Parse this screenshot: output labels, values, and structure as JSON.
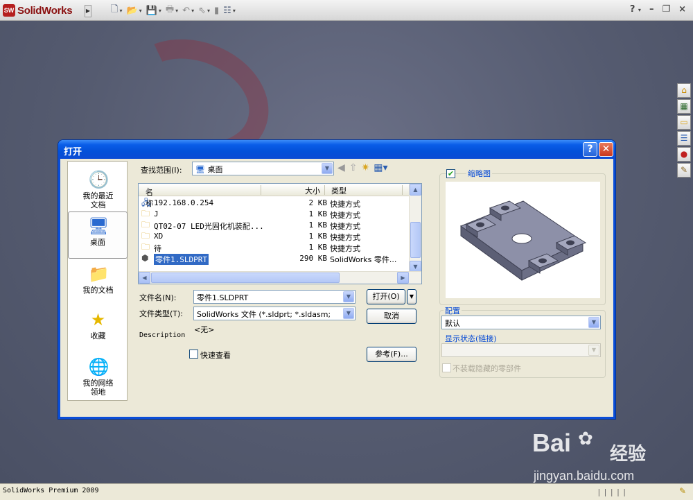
{
  "app": {
    "name": "SolidWorks",
    "logo_mark": "SW",
    "toolbar_icons": [
      "new-icon",
      "open-icon",
      "save-icon",
      "print-icon",
      "undo-icon",
      "select-icon",
      "rebuild-icon",
      "options-icon"
    ],
    "help_label": "?"
  },
  "status_bar": {
    "text": "SolidWorks Premium 2009"
  },
  "watermark": {
    "brand": "Bai",
    "brand_cn": "经验",
    "url": "jingyan.baidu.com"
  },
  "dialog": {
    "title": "打开",
    "places": [
      {
        "label": "我的最近\n文档",
        "icon": "recent-documents-icon"
      },
      {
        "label": "桌面",
        "icon": "desktop-icon",
        "selected": true
      },
      {
        "label": "我的文档",
        "icon": "my-documents-icon"
      },
      {
        "label": "收藏",
        "icon": "favorites-icon"
      },
      {
        "label": "我的网络\n领地",
        "icon": "network-places-icon"
      }
    ],
    "look_in_label": "查找范围(I):",
    "look_in_value": "桌面",
    "columns": {
      "name": "名称",
      "size": "大小",
      "type": "类型"
    },
    "files": [
      {
        "name": "192.168.0.254",
        "size": "2 KB",
        "type": "快捷方式",
        "icon": "network-shortcut-icon"
      },
      {
        "name": "J",
        "size": "1 KB",
        "type": "快捷方式",
        "icon": "folder-shortcut-icon"
      },
      {
        "name": "QT02-07 LED光固化机装配...",
        "size": "1 KB",
        "type": "快捷方式",
        "icon": "folder-shortcut-icon"
      },
      {
        "name": "XD",
        "size": "1 KB",
        "type": "快捷方式",
        "icon": "folder-shortcut-icon"
      },
      {
        "name": "待",
        "size": "1 KB",
        "type": "快捷方式",
        "icon": "folder-shortcut-icon"
      },
      {
        "name": "零件1.SLDPRT",
        "size": "290 KB",
        "type": "SolidWorks 零件...",
        "icon": "sldprt-file-icon",
        "selected": true
      }
    ],
    "file_name_label": "文件名(N):",
    "file_name_value": "零件1.SLDPRT",
    "file_type_label": "文件类型(T):",
    "file_type_value": "SolidWorks 文件 (*.sldprt; *.sldasm;",
    "none_text": "<无>",
    "description_label": "Description",
    "quick_view_label": "快速查看",
    "open_button": "打开(O)",
    "cancel_button": "取消",
    "browse_button": "参考(F)...",
    "thumbnail_label": "缩略图",
    "config_label": "配置",
    "config_value": "默认",
    "display_state_label": "显示状态(链接)",
    "hidden_components_label": "不装载隐藏的零部件"
  }
}
